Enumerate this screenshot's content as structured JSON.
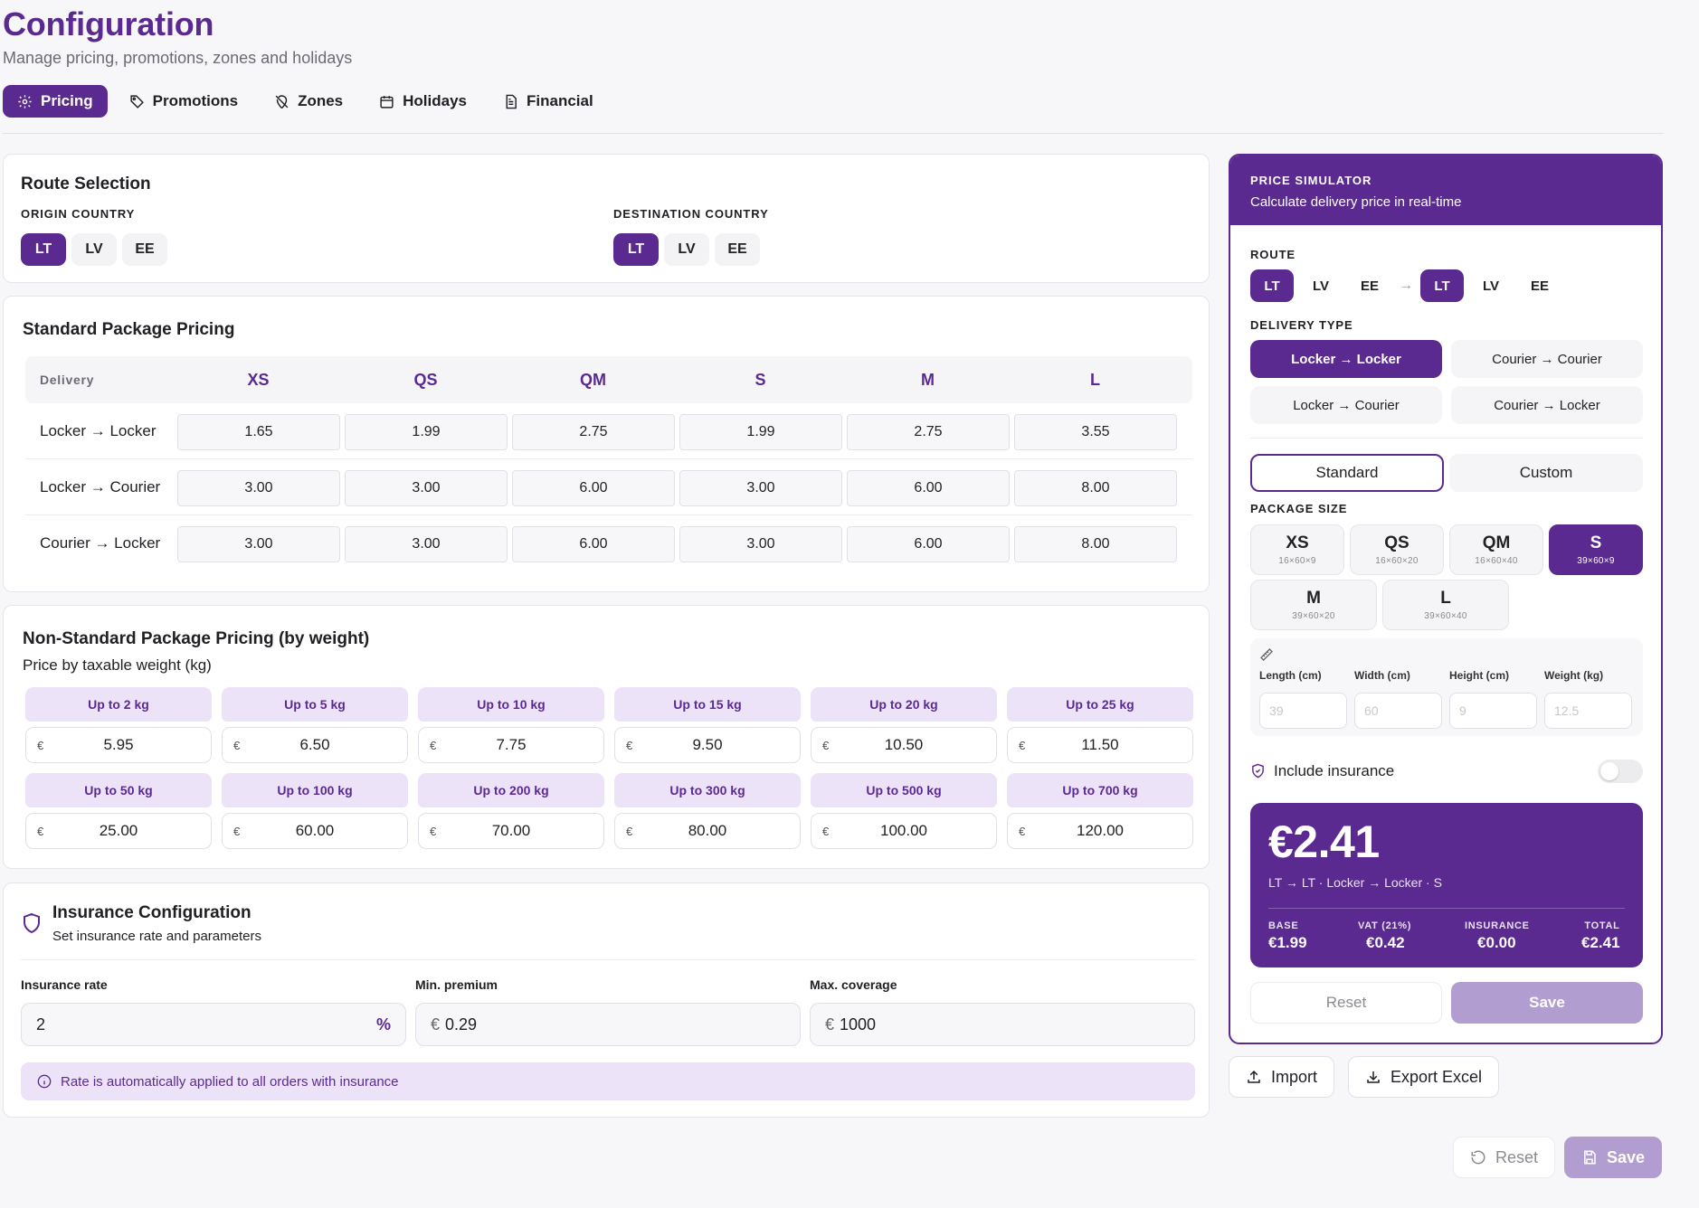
{
  "header": {
    "title": "Configuration",
    "subtitle": "Manage pricing, promotions, zones and holidays"
  },
  "tabs": [
    {
      "label": "Pricing",
      "icon": "gear-icon",
      "active": true
    },
    {
      "label": "Promotions",
      "icon": "tag-icon",
      "active": false
    },
    {
      "label": "Zones",
      "icon": "map-pin-off-icon",
      "active": false
    },
    {
      "label": "Holidays",
      "icon": "calendar-icon",
      "active": false
    },
    {
      "label": "Financial",
      "icon": "document-icon",
      "active": false
    }
  ],
  "route_selection": {
    "title": "Route Selection",
    "origin_label": "ORIGIN COUNTRY",
    "destination_label": "DESTINATION COUNTRY",
    "countries": [
      "LT",
      "LV",
      "EE"
    ],
    "origin_selected": "LT",
    "destination_selected": "LT"
  },
  "standard_pricing": {
    "title": "Standard Package Pricing",
    "columns": [
      "Delivery",
      "XS",
      "QS",
      "QM",
      "S",
      "M",
      "L"
    ],
    "rows": [
      {
        "label": "Locker → Locker",
        "values": [
          "1.65",
          "1.99",
          "2.75",
          "1.99",
          "2.75",
          "3.55"
        ]
      },
      {
        "label": "Locker → Courier",
        "values": [
          "3.00",
          "3.00",
          "6.00",
          "3.00",
          "6.00",
          "8.00"
        ]
      },
      {
        "label": "Courier → Locker",
        "values": [
          "3.00",
          "3.00",
          "6.00",
          "3.00",
          "6.00",
          "8.00"
        ]
      }
    ]
  },
  "nonstandard_pricing": {
    "title": "Non-Standard Package Pricing (by weight)",
    "subtitle": "Price by taxable weight (kg)",
    "currency": "€",
    "tiers": [
      {
        "label": "Up to 2 kg",
        "value": "5.95"
      },
      {
        "label": "Up to 5 kg",
        "value": "6.50"
      },
      {
        "label": "Up to 10 kg",
        "value": "7.75"
      },
      {
        "label": "Up to 15 kg",
        "value": "9.50"
      },
      {
        "label": "Up to 20 kg",
        "value": "10.50"
      },
      {
        "label": "Up to 25 kg",
        "value": "11.50"
      },
      {
        "label": "Up to 50 kg",
        "value": "25.00"
      },
      {
        "label": "Up to 100 kg",
        "value": "60.00"
      },
      {
        "label": "Up to 200 kg",
        "value": "70.00"
      },
      {
        "label": "Up to 300 kg",
        "value": "80.00"
      },
      {
        "label": "Up to 500 kg",
        "value": "100.00"
      },
      {
        "label": "Up to 700 kg",
        "value": "120.00"
      }
    ]
  },
  "insurance": {
    "title": "Insurance Configuration",
    "subtitle": "Set insurance rate and parameters",
    "rate_label": "Insurance rate",
    "rate_value": "2",
    "rate_unit": "%",
    "min_label": "Min. premium",
    "min_value": "0.29",
    "max_label": "Max. coverage",
    "max_value": "1000",
    "currency": "€",
    "info": "Rate is automatically applied to all orders with insurance"
  },
  "simulator": {
    "title": "PRICE SIMULATOR",
    "subtitle": "Calculate delivery price in real-time",
    "route_label": "ROUTE",
    "countries": [
      "LT",
      "LV",
      "EE"
    ],
    "route_from": "LT",
    "route_to": "LT",
    "arrow": "→",
    "delivery_label": "DELIVERY TYPE",
    "delivery_types": [
      "Locker → Locker",
      "Courier → Courier",
      "Locker → Courier",
      "Courier → Locker"
    ],
    "delivery_selected": "Locker → Locker",
    "mode_standard": "Standard",
    "mode_custom": "Custom",
    "package_label": "PACKAGE SIZE",
    "sizes": [
      {
        "name": "XS",
        "dims": "16×60×9"
      },
      {
        "name": "QS",
        "dims": "16×60×20"
      },
      {
        "name": "QM",
        "dims": "16×60×40"
      },
      {
        "name": "S",
        "dims": "39×60×9"
      },
      {
        "name": "M",
        "dims": "39×60×20"
      },
      {
        "name": "L",
        "dims": "39×60×40"
      }
    ],
    "size_selected": "S",
    "dims": [
      {
        "label": "Length (cm)",
        "placeholder": "39"
      },
      {
        "label": "Width (cm)",
        "placeholder": "60"
      },
      {
        "label": "Height (cm)",
        "placeholder": "9"
      },
      {
        "label": "Weight (kg)",
        "placeholder": "12.5"
      }
    ],
    "insurance_label": "Include insurance",
    "insurance_on": false,
    "price": "€2.41",
    "route_summary": "LT → LT · Locker → Locker · S",
    "breakdown": [
      {
        "key": "BASE",
        "value": "€1.99"
      },
      {
        "key": "VAT (21%)",
        "value": "€0.42"
      },
      {
        "key": "INSURANCE",
        "value": "€0.00"
      },
      {
        "key": "TOTAL",
        "value": "€2.41"
      }
    ],
    "reset_label": "Reset",
    "save_label": "Save"
  },
  "actions": {
    "import_label": "Import",
    "export_label": "Export Excel",
    "reset_label": "Reset",
    "save_label": "Save"
  },
  "colors": {
    "accent": "#5b2a91",
    "accent_light": "#ede3f9",
    "save_disabled": "#b29dd0"
  }
}
